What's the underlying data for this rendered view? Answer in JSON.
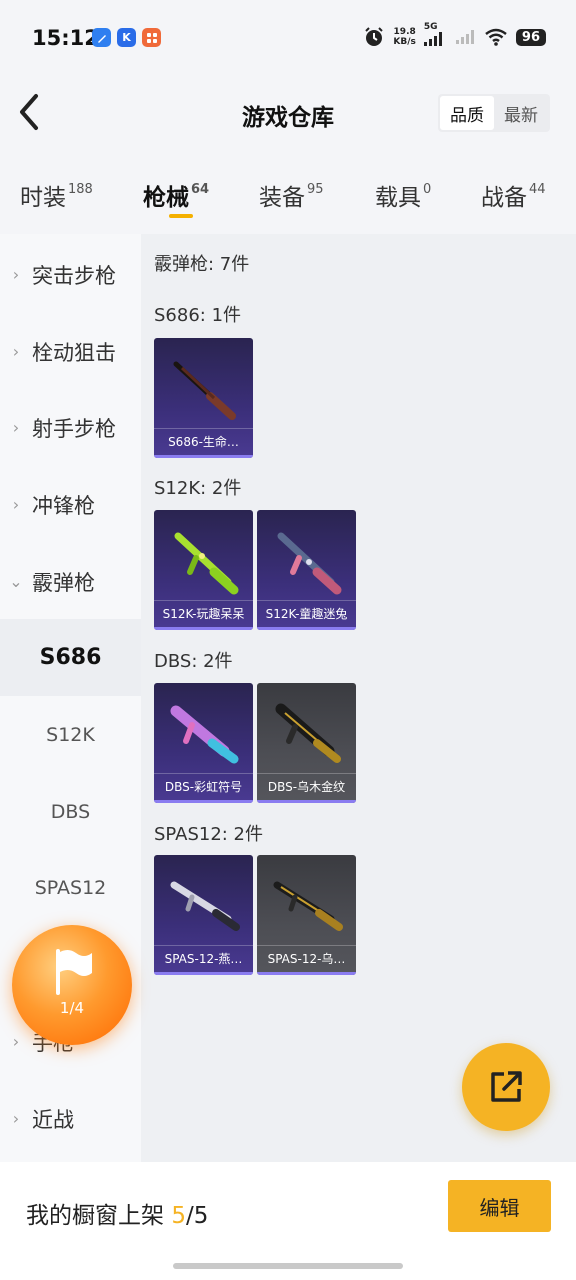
{
  "status_bar": {
    "time": "15:12",
    "net_speed_value": "19.8",
    "net_speed_unit": "KB/s",
    "network": "5G",
    "battery": "96",
    "apps": [
      {
        "icon": "notes-app-icon",
        "letter": "",
        "color": "#2f7ff0"
      },
      {
        "icon": "k-app-icon",
        "letter": "K",
        "color": "#2a6ce8"
      },
      {
        "icon": "grid-app-icon",
        "letter": "",
        "color": "#f06a3a"
      }
    ]
  },
  "header": {
    "title": "游戏仓库",
    "sort_options": [
      "品质",
      "最新"
    ]
  },
  "tabs": [
    {
      "label": "时装",
      "count": "188"
    },
    {
      "label": "枪械",
      "count": "64"
    },
    {
      "label": "装备",
      "count": "95"
    },
    {
      "label": "载具",
      "count": "0"
    },
    {
      "label": "战备",
      "count": "44"
    }
  ],
  "sidebar": {
    "categories": [
      "突击步枪",
      "栓动狙击",
      "射手步枪",
      "冲锋枪",
      "霰弹枪"
    ],
    "sub_items": [
      "S686",
      "S12K",
      "DBS",
      "SPAS12"
    ],
    "bottom_categories": [
      "手枪",
      "近战"
    ]
  },
  "content": {
    "summary": "霰弹枪: 7件",
    "groups": [
      {
        "title": "S686: 1件",
        "items": [
          {
            "name": "S686-生命…",
            "rarity": "purple"
          }
        ]
      },
      {
        "title": "S12K: 2件",
        "items": [
          {
            "name": "S12K-玩趣呆呆",
            "rarity": "purple"
          },
          {
            "name": "S12K-童趣迷兔",
            "rarity": "purple"
          }
        ]
      },
      {
        "title": "DBS: 2件",
        "items": [
          {
            "name": "DBS-彩虹符号",
            "rarity": "purple"
          },
          {
            "name": "DBS-乌木金纹",
            "rarity": "gray"
          }
        ]
      },
      {
        "title": "SPAS12: 2件",
        "items": [
          {
            "name": "SPAS-12-燕…",
            "rarity": "purple"
          },
          {
            "name": "SPAS-12-乌…",
            "rarity": "gray"
          }
        ]
      }
    ]
  },
  "task_ball": {
    "progress": "1/4"
  },
  "bottom_bar": {
    "label": "我的橱窗上架",
    "current": "5",
    "separator": "/",
    "total": "5",
    "edit_label": "编辑"
  },
  "colors": {
    "accent": "#f5b324",
    "purple_card": "#3b2f7a",
    "gray_card": "#4d4e54"
  }
}
